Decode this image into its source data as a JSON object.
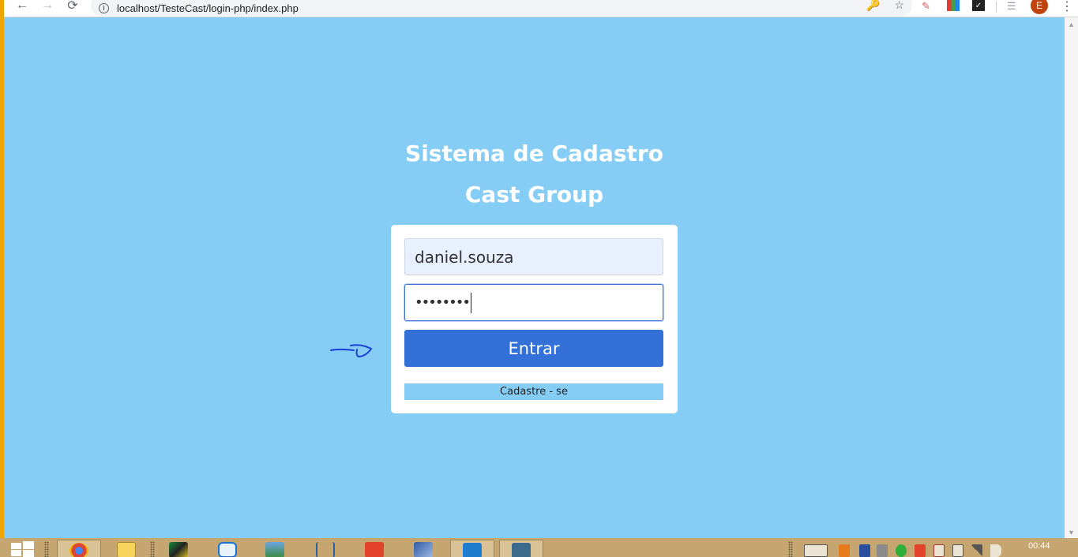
{
  "browser": {
    "url": "localhost/TesteCast/login-php/index.php",
    "avatar_letter": "E"
  },
  "page": {
    "title_line1": "Sistema de Cadastro",
    "title_line2": "Cast Group"
  },
  "login": {
    "username_value": "daniel.souza",
    "password_masked": "••••••••",
    "enter_label": "Entrar",
    "register_label": "Cadastre - se"
  },
  "taskbar": {
    "clock": "00:44",
    "apps": [
      "chrome-icon",
      "file-explorer-icon",
      "app-icon",
      "teamviewer-icon",
      "photos-icon",
      "git-icon",
      "git-scm-icon",
      "outlook-icon",
      "vscode-icon",
      "mysql-workbench-icon"
    ]
  },
  "colors": {
    "page_bg": "#86cdf6",
    "button_primary": "#3371d8",
    "taskbar": "#c5a570",
    "edge": "#f0a400"
  }
}
